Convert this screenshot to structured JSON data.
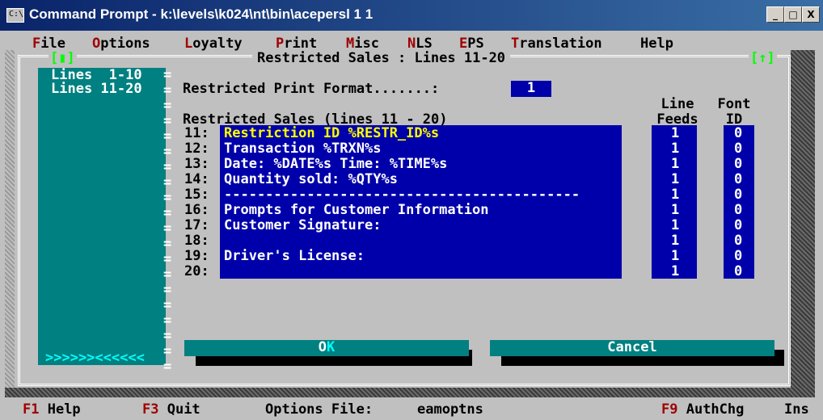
{
  "window": {
    "title": "Command Prompt - k:\\levels\\k024\\nt\\bin\\acepersl 1 1",
    "icon_label": "C:\\",
    "controls": {
      "minimize": "_",
      "maximize": "□",
      "close": "X"
    }
  },
  "menu": [
    {
      "hotkey": "F",
      "rest": "ile"
    },
    {
      "hotkey": "O",
      "rest": "ptions"
    },
    {
      "hotkey": "L",
      "rest": "oyalty"
    },
    {
      "hotkey": "P",
      "rest": "rint"
    },
    {
      "hotkey": "M",
      "rest": "isc"
    },
    {
      "hotkey": "N",
      "rest": "LS"
    },
    {
      "hotkey": "E",
      "rest": "PS"
    },
    {
      "hotkey": "T",
      "rest": "ranslation"
    },
    {
      "hotkey": "",
      "rest": "Help"
    }
  ],
  "dialog": {
    "title": "Restricted Sales : Lines 11-20",
    "scroll_left": "[▮]",
    "scroll_right": "[↑]"
  },
  "sidebar": {
    "items": [
      "Lines  1-10",
      "Lines 11-20"
    ],
    "separator_rows": "=\n=\n=\n=\n=\n=\n=\n=\n=\n=\n=\n=\n=\n=\n=\n=\n=\n=\n=\n=",
    "arrows": ">>>>>><<<<<<"
  },
  "print_format": {
    "label": "Restricted Print Format.......:",
    "value": "1"
  },
  "restricted": {
    "header": "Restricted Sales (lines 11 - 20)",
    "col_line_feeds": "Line\nFeeds",
    "col_font_id": "Font\nID",
    "lines": [
      {
        "num": "11:",
        "text": "Restriction ID %RESTR_ID%s",
        "line_feeds": "1",
        "font_id": "0"
      },
      {
        "num": "12:",
        "text": "Transaction %TRXN%s",
        "line_feeds": "1",
        "font_id": "0"
      },
      {
        "num": "13:",
        "text": "Date: %DATE%s Time: %TIME%s",
        "line_feeds": "1",
        "font_id": "0"
      },
      {
        "num": "14:",
        "text": "Quantity sold: %QTY%s",
        "line_feeds": "1",
        "font_id": "0"
      },
      {
        "num": "15:",
        "text": "-------------------------------------------",
        "line_feeds": "1",
        "font_id": "0"
      },
      {
        "num": "16:",
        "text": "Prompts for Customer Information",
        "line_feeds": "1",
        "font_id": "0"
      },
      {
        "num": "17:",
        "text": "Customer Signature:",
        "line_feeds": "1",
        "font_id": "0"
      },
      {
        "num": "18:",
        "text": "",
        "line_feeds": "1",
        "font_id": "0"
      },
      {
        "num": "19:",
        "text": "Driver's License:",
        "line_feeds": "1",
        "font_id": "0"
      },
      {
        "num": "20:",
        "text": "",
        "line_feeds": "1",
        "font_id": "0"
      }
    ]
  },
  "buttons": {
    "ok": {
      "first": "O",
      "rest": "K"
    },
    "cancel": "Cancel"
  },
  "status": {
    "f1_key": "F1",
    "f1_label": " Help",
    "f3_key": "F3",
    "f3_label": " Quit",
    "options_label": "Options File:",
    "options_value": "eamoptns",
    "f9_key": "F9",
    "f9_label": " AuthChg",
    "ins": "Ins"
  },
  "colors": {
    "console_bg": "#c0c0c0",
    "sidebar_bg": "#008080",
    "field_bg": "#0000aa",
    "hotkey": "#a00000",
    "active_line": "#ffff00"
  }
}
